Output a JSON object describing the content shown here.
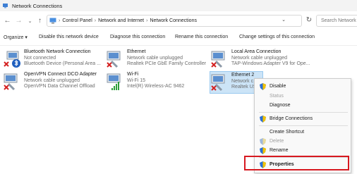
{
  "window": {
    "title": "Network Connections"
  },
  "address": {
    "crumbs": [
      "Control Panel",
      "Network and Internet",
      "Network Connections"
    ],
    "search_placeholder": "Search Network C"
  },
  "toolbar": {
    "organize": "Organize ▾",
    "disable": "Disable this network device",
    "diagnose": "Diagnose this connection",
    "rename": "Rename this connection",
    "change": "Change settings of this connection"
  },
  "connections": [
    {
      "name": "Bluetooth Network Connection",
      "status": "Not connected",
      "device": "Bluetooth Device (Personal Area ..."
    },
    {
      "name": "Ethernet",
      "status": "Network cable unplugged",
      "device": "Realtek PCIe GbE Family Controller"
    },
    {
      "name": "Local Area Connection",
      "status": "Network cable unplugged",
      "device": "TAP-Windows Adapter V9 for Ope..."
    },
    {
      "name": "OpenVPN Connect DCO Adapter",
      "status": "Network cable unplugged",
      "device": "OpenVPN Data Channel Offload"
    },
    {
      "name": "Wi-Fi",
      "status": "Wi-Fi 15",
      "device": "Intel(R) Wireless-AC 9462"
    },
    {
      "name": "Ethernet 2",
      "status": "Network c",
      "device": "Realtek US"
    }
  ],
  "context_menu": {
    "disable": "Disable",
    "status": "Status",
    "diagnose": "Diagnose",
    "bridge": "Bridge Connections",
    "shortcut": "Create Shortcut",
    "delete": "Delete",
    "rename": "Rename",
    "properties": "Properties"
  },
  "colors": {
    "selection": "#cce4f7",
    "highlight_box": "#d71920",
    "shield_blue": "#2a6fd6",
    "shield_yellow": "#f2c200"
  }
}
